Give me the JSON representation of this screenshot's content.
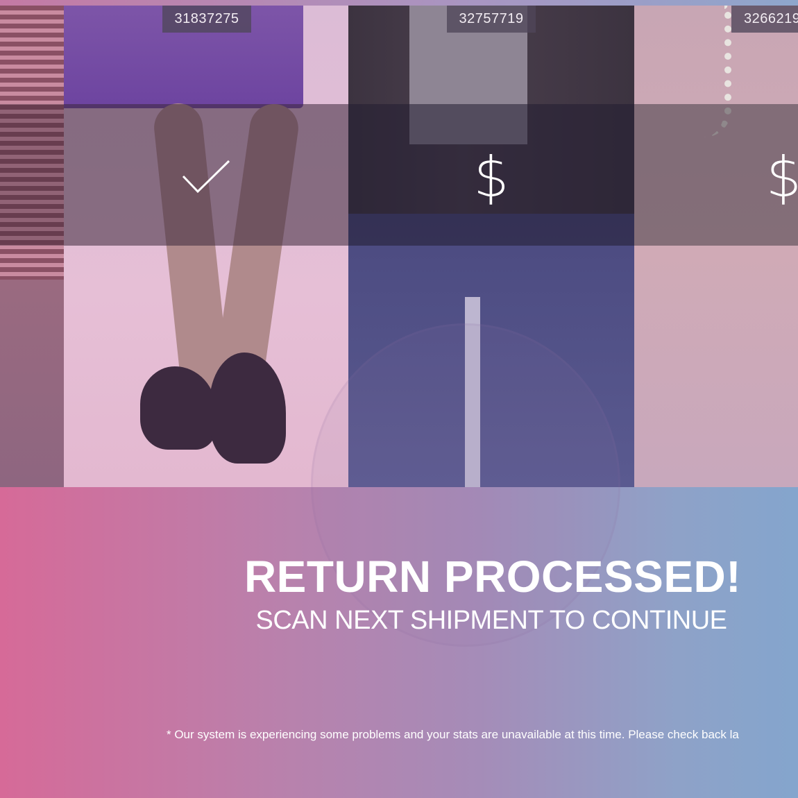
{
  "items": [
    {
      "sku": "31837275",
      "status_icon": "check-icon"
    },
    {
      "sku": "32757719",
      "status_icon": "dollar-icon",
      "symbol": "$"
    },
    {
      "sku": "3266219",
      "status_icon": "dollar-icon",
      "symbol": "$"
    }
  ],
  "message": {
    "headline": "RETURN PROCESSED!",
    "subline": "SCAN NEXT SHIPMENT TO CONTINUE",
    "footnote": "* Our system is experiencing some problems and your stats are unavailable at this time. Please check back la"
  },
  "colors": {
    "gradient_left": "#d66a98",
    "gradient_right": "#84a5cd",
    "text": "#ffffff"
  }
}
